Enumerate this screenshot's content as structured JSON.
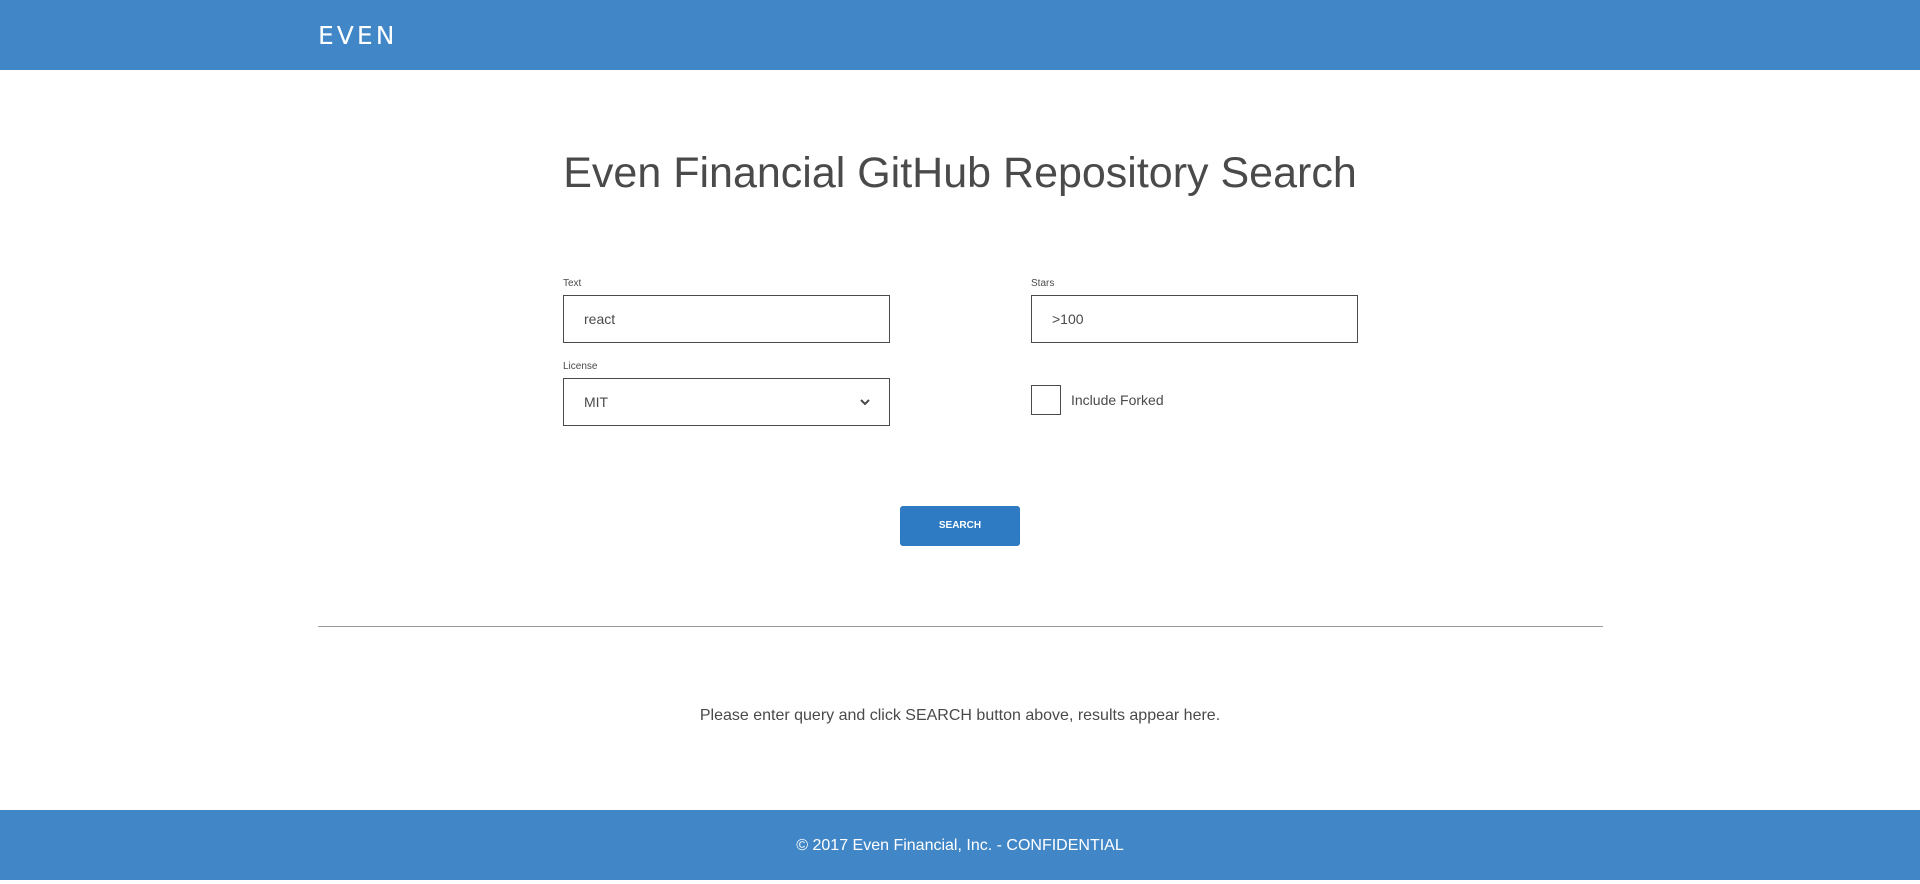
{
  "header": {
    "logo_text": "EVEN"
  },
  "main": {
    "title": "Even Financial GitHub Repository Search",
    "form": {
      "text": {
        "label": "Text",
        "value": "react"
      },
      "stars": {
        "label": "Stars",
        "value": ">100"
      },
      "license": {
        "label": "License",
        "selected": "MIT"
      },
      "include_forked": {
        "label": "Include Forked",
        "checked": false
      },
      "search_button_label": "SEARCH"
    },
    "results_placeholder": "Please enter query and click SEARCH button above, results appear here."
  },
  "footer": {
    "text": "© 2017 Even Financial, Inc. - CONFIDENTIAL"
  },
  "colors": {
    "brand_blue": "#4187c7",
    "button_blue": "#2f7bc3",
    "text_gray": "#4a4a4a"
  }
}
